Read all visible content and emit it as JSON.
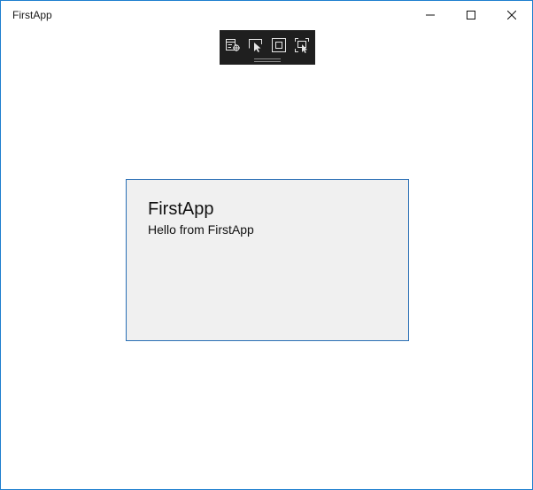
{
  "window": {
    "title": "FirstApp",
    "border_color": "#1e7fcf"
  },
  "caption_buttons": {
    "minimize_icon": "minimize-icon",
    "maximize_icon": "maximize-icon",
    "close_icon": "close-icon"
  },
  "debug_toolbar": {
    "background": "#1f1f1f",
    "tools": [
      {
        "icon": "live-visual-tree-icon"
      },
      {
        "icon": "select-element-icon"
      },
      {
        "icon": "display-layout-adorners-icon"
      },
      {
        "icon": "track-focused-element-icon"
      }
    ]
  },
  "card": {
    "title": "FirstApp",
    "subtitle": "Hello from FirstApp",
    "background": "#f0f0f0",
    "border_color": "#2a6fb5"
  }
}
